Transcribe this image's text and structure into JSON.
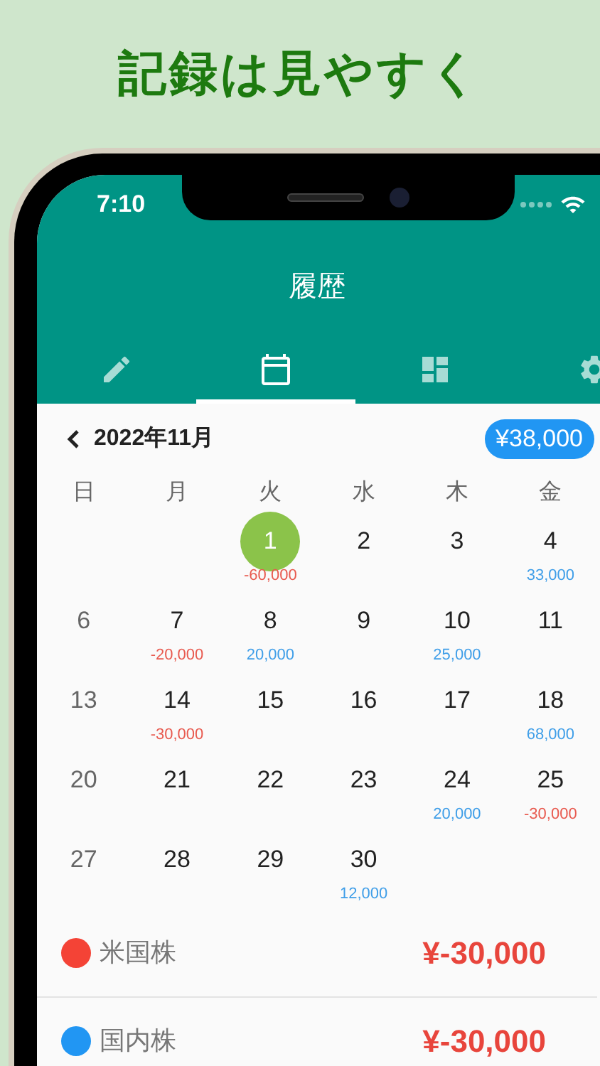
{
  "headline": "記録は見やすく",
  "status_bar": {
    "time": "7:10"
  },
  "header": {
    "title": "履歴"
  },
  "tabs": [
    {
      "kind": "edit",
      "selected": false
    },
    {
      "kind": "calendar",
      "selected": true
    },
    {
      "kind": "dashboard",
      "selected": false
    },
    {
      "kind": "settings",
      "selected": false
    }
  ],
  "calendar": {
    "month": "2022年11月",
    "total": "¥38,000",
    "weekdays": [
      "日",
      "月",
      "火",
      "水",
      "木",
      "金"
    ],
    "weeks": [
      [
        {
          "blank": true
        },
        {
          "blank": true
        },
        {
          "day": "1",
          "selected": true,
          "amount": "-60,000",
          "color": "#e85a4f"
        },
        {
          "day": "2",
          "selected": false
        },
        {
          "day": "3",
          "selected": false
        },
        {
          "day": "4",
          "selected": false,
          "amount": "33,000",
          "color": "#3f9ee8"
        }
      ],
      [
        {
          "day": "6",
          "selected": false
        },
        {
          "day": "7",
          "selected": false,
          "amount": "-20,000",
          "color": "#e85a4f"
        },
        {
          "day": "8",
          "selected": false,
          "amount": "20,000",
          "color": "#3f9ee8"
        },
        {
          "day": "9",
          "selected": false
        },
        {
          "day": "10",
          "selected": false,
          "amount": "25,000",
          "color": "#3f9ee8"
        },
        {
          "day": "11",
          "selected": false
        }
      ],
      [
        {
          "day": "13",
          "selected": false
        },
        {
          "day": "14",
          "selected": false,
          "amount": "-30,000",
          "color": "#e85a4f"
        },
        {
          "day": "15",
          "selected": false
        },
        {
          "day": "16",
          "selected": false
        },
        {
          "day": "17",
          "selected": false
        },
        {
          "day": "18",
          "selected": false,
          "amount": "68,000",
          "color": "#3f9ee8"
        }
      ],
      [
        {
          "day": "20",
          "selected": false
        },
        {
          "day": "21",
          "selected": false
        },
        {
          "day": "22",
          "selected": false
        },
        {
          "day": "23",
          "selected": false
        },
        {
          "day": "24",
          "selected": false,
          "amount": "20,000",
          "color": "#3f9ee8"
        },
        {
          "day": "25",
          "selected": false,
          "amount": "-30,000",
          "color": "#e85a4f"
        }
      ],
      [
        {
          "day": "27",
          "selected": false
        },
        {
          "day": "28",
          "selected": false
        },
        {
          "day": "29",
          "selected": false
        },
        {
          "day": "30",
          "selected": false,
          "amount": "12,000",
          "color": "#3f9ee8"
        }
      ]
    ]
  },
  "entries": [
    {
      "label": "米国株",
      "color": "#f44336",
      "amount": "¥-30,000"
    },
    {
      "label": "国内株",
      "color": "#2196f3",
      "amount": "¥-30,000"
    }
  ]
}
